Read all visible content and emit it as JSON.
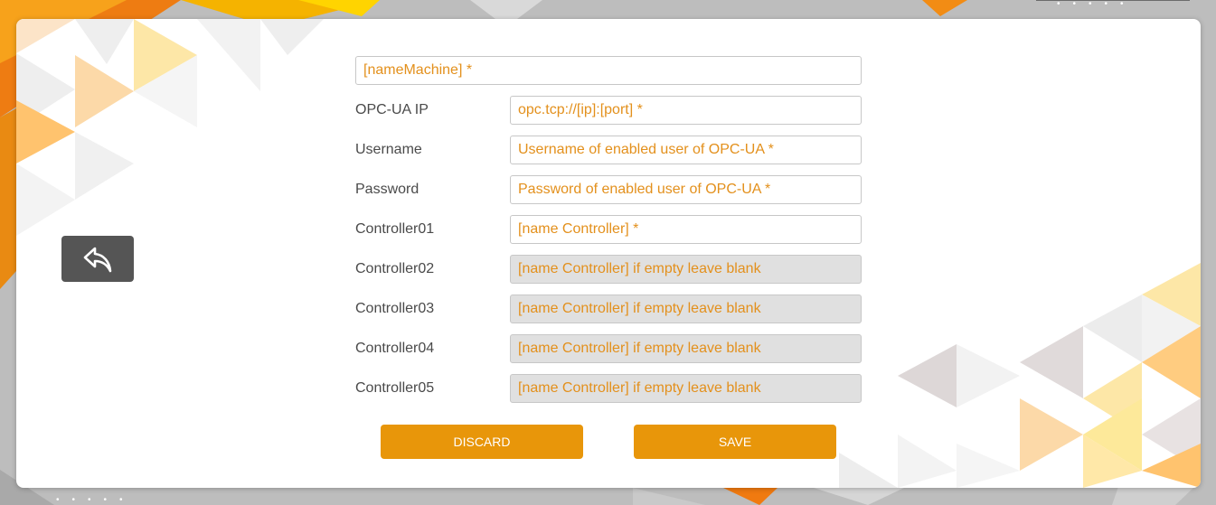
{
  "colors": {
    "accent": "#e8960a",
    "placeholder_text": "#e3901c",
    "label_text": "#4a4a4a",
    "back_button_bg": "#555555",
    "disabled_field_bg": "#e0e0e0"
  },
  "back_button": {
    "icon": "undo-arrow-icon"
  },
  "form": {
    "machine_name": {
      "placeholder": "[nameMachine] *"
    },
    "fields": [
      {
        "label": "OPC-UA IP",
        "placeholder": "opc.tcp://[ip]:[port] *",
        "enabled": true
      },
      {
        "label": "Username",
        "placeholder": "Username of enabled user of OPC-UA *",
        "enabled": true
      },
      {
        "label": "Password",
        "placeholder": "Password of enabled user of OPC-UA *",
        "enabled": true
      },
      {
        "label": "Controller01",
        "placeholder": "[name Controller] *",
        "enabled": true
      },
      {
        "label": "Controller02",
        "placeholder": "[name Controller] if empty leave blank",
        "enabled": false
      },
      {
        "label": "Controller03",
        "placeholder": "[name Controller] if empty leave blank",
        "enabled": false
      },
      {
        "label": "Controller04",
        "placeholder": "[name Controller] if empty leave blank",
        "enabled": false
      },
      {
        "label": "Controller05",
        "placeholder": "[name Controller] if empty leave blank",
        "enabled": false
      }
    ]
  },
  "buttons": {
    "discard": "DISCARD",
    "save": "SAVE"
  }
}
